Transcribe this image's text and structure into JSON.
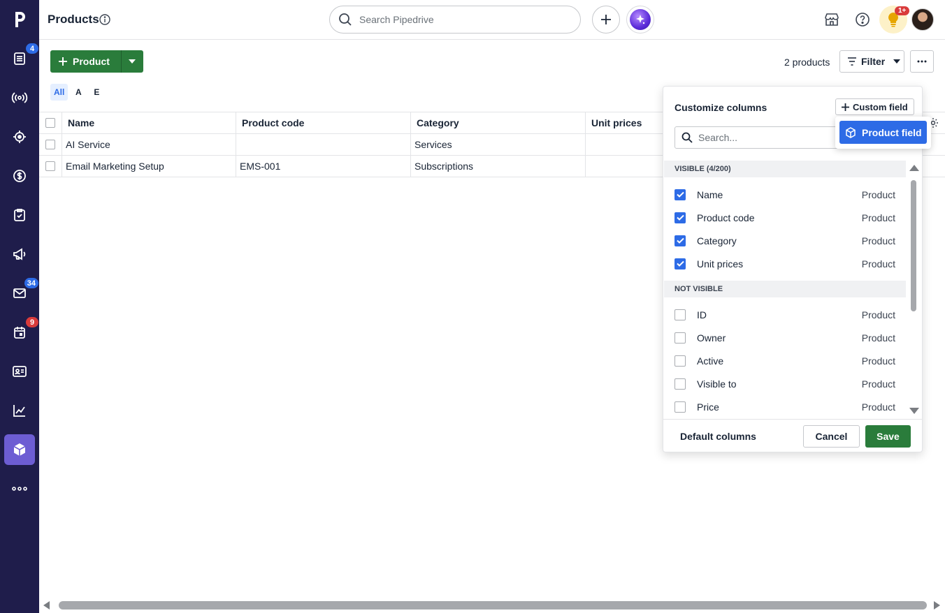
{
  "header": {
    "title": "Products",
    "search_placeholder": "Search Pipedrive",
    "notifications_badge": "1+"
  },
  "sidebar": {
    "items": [
      {
        "name": "leads",
        "badge": "4",
        "badge_color": "#2d6be6"
      },
      {
        "name": "deals-pipeline",
        "badge": ""
      },
      {
        "name": "projects",
        "badge": ""
      },
      {
        "name": "deals",
        "badge": ""
      },
      {
        "name": "activities",
        "badge": ""
      },
      {
        "name": "campaigns",
        "badge": ""
      },
      {
        "name": "mail",
        "badge": "34",
        "badge_color": "#2d6be6"
      },
      {
        "name": "calendar",
        "badge": "9",
        "badge_color": "#d93b3b"
      },
      {
        "name": "contacts",
        "badge": ""
      },
      {
        "name": "insights",
        "badge": ""
      },
      {
        "name": "products",
        "badge": "",
        "active": true
      },
      {
        "name": "more",
        "badge": ""
      }
    ]
  },
  "toolbar": {
    "add_label": "Product",
    "count_label": "2 products",
    "filter_label": "Filter"
  },
  "letters": [
    "All",
    "A",
    "E"
  ],
  "table": {
    "columns": [
      "Name",
      "Product code",
      "Category",
      "Unit prices"
    ],
    "rows": [
      [
        "AI Service",
        "",
        "Services",
        ""
      ],
      [
        "Email Marketing Setup",
        "EMS-001",
        "Subscriptions",
        ""
      ]
    ]
  },
  "customize": {
    "title": "Customize columns",
    "custom_field_label": "Custom field",
    "search_placeholder": "Search...",
    "visible_heading": "VISIBLE (4/200)",
    "not_visible_heading": "NOT VISIBLE",
    "visible_fields": [
      {
        "name": "Name",
        "source": "Product"
      },
      {
        "name": "Product code",
        "source": "Product"
      },
      {
        "name": "Category",
        "source": "Product"
      },
      {
        "name": "Unit prices",
        "source": "Product"
      }
    ],
    "hidden_fields": [
      {
        "name": "ID",
        "source": "Product"
      },
      {
        "name": "Owner",
        "source": "Product"
      },
      {
        "name": "Active",
        "source": "Product"
      },
      {
        "name": "Visible to",
        "source": "Product"
      },
      {
        "name": "Price",
        "source": "Product"
      }
    ],
    "default_label": "Default columns",
    "cancel_label": "Cancel",
    "save_label": "Save",
    "dropdown_item": "Product field"
  },
  "colors": {
    "sidebar": "#1f1d4b",
    "primary_green": "#2a7c3b",
    "accent_blue": "#2d6be6",
    "active_nav": "#6d5dd3"
  }
}
